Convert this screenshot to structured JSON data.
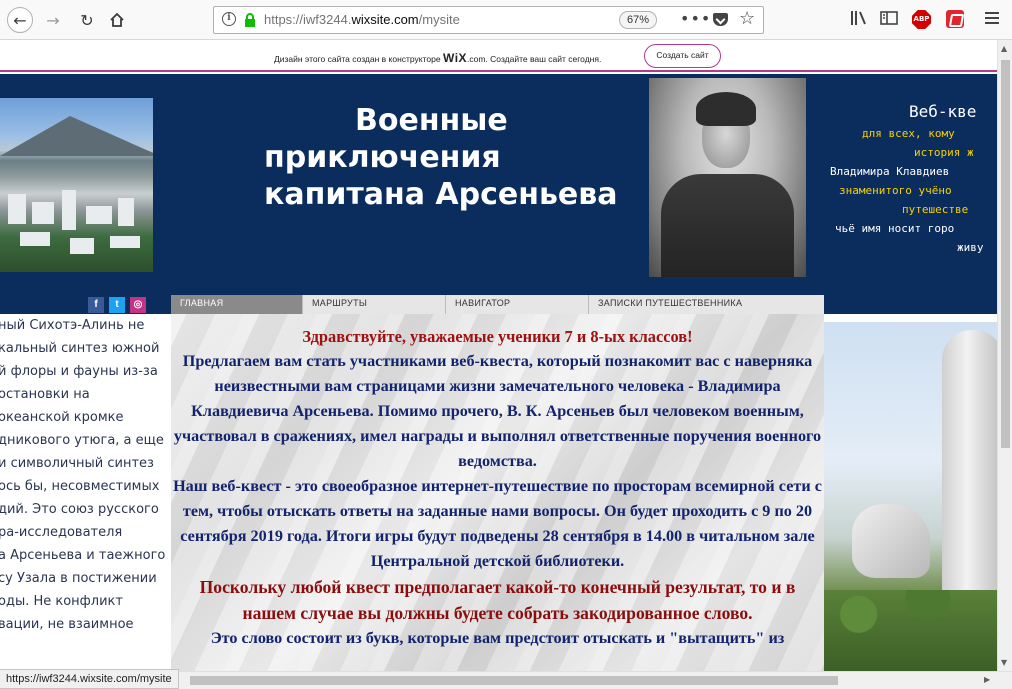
{
  "browser": {
    "url_prefix": "https://iwf3244.",
    "url_domain": "wixsite.com",
    "url_path": "/mysite",
    "zoom": "67%",
    "status_url": "https://iwf3244.wixsite.com/mysite"
  },
  "wix_banner": {
    "text_before": "Дизайн этого сайта создан в конструкторе",
    "brand": "WiX",
    "text_after": ".com. Создайте ваш сайт сегодня.",
    "button": "Создать сайт"
  },
  "header": {
    "title_line1": "Военные",
    "title_line2": "приключения",
    "title_line3": "капитана Арсеньева",
    "quest_lines": [
      "Веб-кве",
      "для всех, кому",
      "история ж",
      "Владимира Клавдиев",
      "знаменитого учёно",
      "путешестве",
      "чьё имя носит горо",
      "живу"
    ]
  },
  "social": {
    "facebook": "f",
    "twitter": "t",
    "instagram": "◎"
  },
  "nav": {
    "items": [
      "ГЛАВНАЯ",
      "МАРШРУТЫ",
      "НАВИГАТОР",
      "ЗАПИСКИ ПУТЕШЕСТВЕННИКА"
    ]
  },
  "left_text": [
    "ный Сихотэ-Алинь не",
    "кальный синтез южной",
    "й флоры и фауны из-за",
    "остановки на",
    "океанской кромке",
    "дникового утюга, а еще",
    "и символичный синтез",
    "ось бы, несовместимых",
    "дий. Это союз русского",
    "ра-исследователя",
    "а Арсеньева и таежного",
    "су Узала в постижении",
    "оды. Не конфликт",
    "вации, не взаимное"
  ],
  "content": {
    "greeting": "Здравствуйте, уважаемые ученики 7 и 8-ых классов!",
    "paragraph1": "Предлагаем вам стать участниками веб-квеста, который познакомит вас с наверняка неизвестными вам страницами жизни замечательного человека - Владимира Клавдиевича Арсеньева. Помимо прочего, В. К. Арсеньев был человеком военным, участвовал в сражениях, имел награды и выполнял ответственные поручения военного ведомства.",
    "paragraph2": "Наш веб-квест - это своеобразное интернет-путешествие по просторам всемирной сети с тем, чтобы отыскать ответы на заданные нами вопросы. Он будет проходить с 9 по 20 сентября 2019 года. Итоги игры будут подведены 28 сентября в 14.00 в читальном зале Центральной детской библиотеки.",
    "emphasis": "Поскольку любой квест предполагает какой-то конечный результат, то и в нашем случае вы должны будете собрать закодированное слово.",
    "paragraph3": "Это слово состоит из букв, которые вам предстоит отыскать и \"вытащить\" из"
  }
}
